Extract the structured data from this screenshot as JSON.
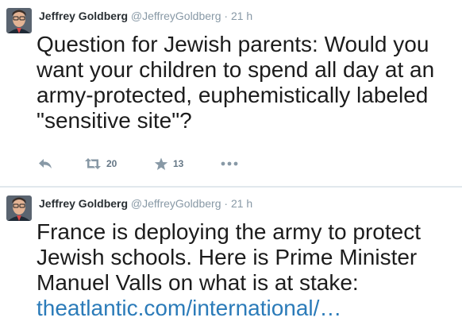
{
  "tweets": [
    {
      "author_name": "Jeffrey Goldberg",
      "author_handle": "@JeffreyGoldberg",
      "separator": "·",
      "time": "21 h",
      "text": "Question for Jewish parents: Would you want your children to spend all day at an army-protected, euphemistically labeled \"sensitive site\"?",
      "retweets": "20",
      "favorites": "13"
    },
    {
      "author_name": "Jeffrey Goldberg",
      "author_handle": "@JeffreyGoldberg",
      "separator": "·",
      "time": "21 h",
      "text": "France is deploying the army to protect Jewish schools. Here is Prime Minister Manuel Valls on what is at stake:",
      "link": "theatlantic.com/international/…"
    }
  ],
  "icons": {
    "reply": "reply-icon",
    "retweet": "retweet-icon",
    "favorite": "star-icon",
    "more": "more-icon"
  },
  "colors": {
    "name": "#292f33",
    "meta": "#8899a6",
    "link": "#2b7bb9",
    "action": "#8899a6",
    "divider": "#e1e8ed"
  }
}
